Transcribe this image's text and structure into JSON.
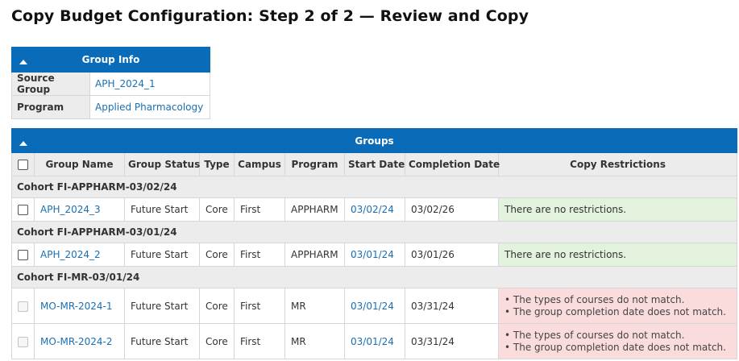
{
  "page": {
    "title": "Copy Budget Configuration: Step 2 of 2 — Review and Copy"
  },
  "group_info": {
    "header": "Group Info",
    "rows": [
      {
        "label": "Source Group",
        "value": "APH_2024_1"
      },
      {
        "label": "Program",
        "value": "Applied Pharmacology"
      }
    ]
  },
  "groups": {
    "header": "Groups",
    "columns": [
      "Group Name",
      "Group Status",
      "Type",
      "Campus",
      "Program",
      "Start Date",
      "Completion Date",
      "Copy Restrictions"
    ],
    "cohorts": [
      {
        "label": "Cohort FI-APPHARM-03/02/24",
        "rows": [
          {
            "name": "APH_2024_3",
            "status": "Future Start",
            "type": "Core",
            "campus": "First",
            "program": "APPHARM",
            "start": "03/02/24",
            "completion": "03/02/26",
            "restrictions": [
              "There are no restrictions."
            ],
            "restricted": false
          }
        ]
      },
      {
        "label": "Cohort FI-APPHARM-03/01/24",
        "rows": [
          {
            "name": "APH_2024_2",
            "status": "Future Start",
            "type": "Core",
            "campus": "First",
            "program": "APPHARM",
            "start": "03/01/24",
            "completion": "03/01/26",
            "restrictions": [
              "There are no restrictions."
            ],
            "restricted": false
          }
        ]
      },
      {
        "label": "Cohort FI-MR-03/01/24",
        "rows": [
          {
            "name": "MO-MR-2024-1",
            "status": "Future Start",
            "type": "Core",
            "campus": "First",
            "program": "MR",
            "start": "03/01/24",
            "completion": "03/31/24",
            "restrictions": [
              "• The types of courses do not match.",
              "• The group completion date does not match."
            ],
            "restricted": true
          },
          {
            "name": "MO-MR-2024-2",
            "status": "Future Start",
            "type": "Core",
            "campus": "First",
            "program": "MR",
            "start": "03/01/24",
            "completion": "03/31/24",
            "restrictions": [
              "• The types of courses do not match.",
              "• The group completion date does not match."
            ],
            "restricted": true
          }
        ]
      }
    ]
  },
  "colors": {
    "header_blue": "#0a6cb8",
    "link_blue": "#1a6fb3",
    "ok_bg": "#e3f2dc",
    "bad_bg": "#fbdcdc"
  },
  "icons": {
    "collapse": "chevron-up-icon",
    "checkbox": "checkbox-icon"
  }
}
